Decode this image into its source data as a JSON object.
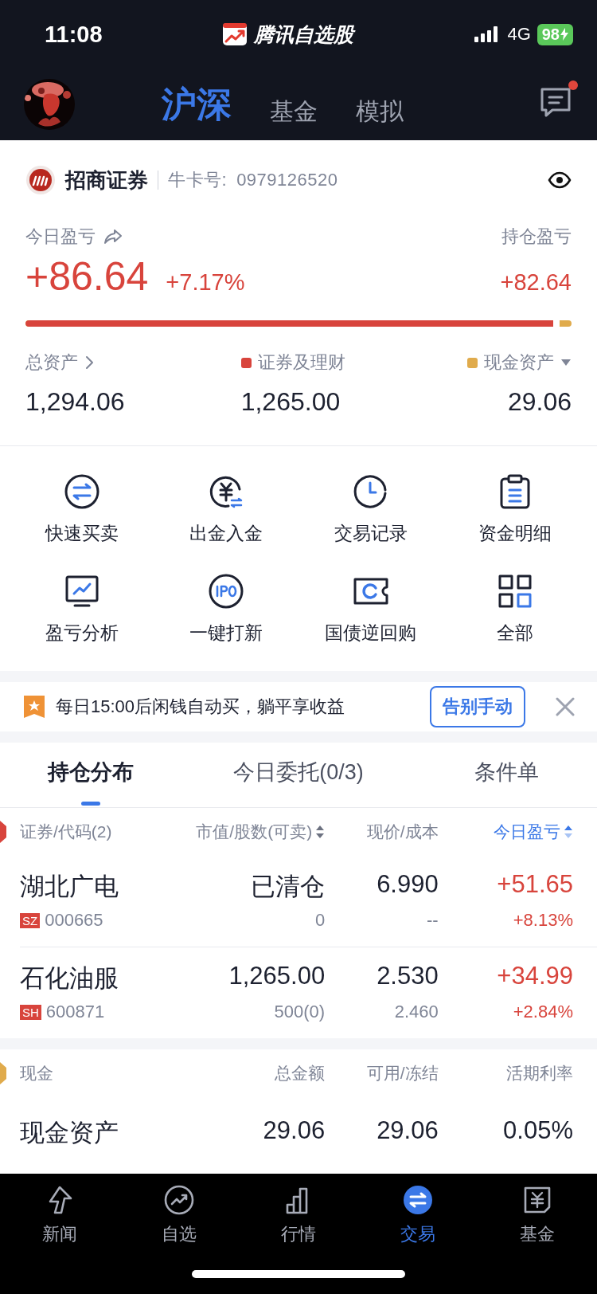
{
  "status_bar": {
    "time": "11:08",
    "app_name": "腾讯自选股",
    "network": "4G",
    "battery": "98"
  },
  "header": {
    "tabs": [
      {
        "label": "沪深",
        "selected": true
      },
      {
        "label": "基金",
        "selected": false
      },
      {
        "label": "模拟",
        "selected": false
      }
    ],
    "messages_unread": true
  },
  "account": {
    "broker": "招商证券",
    "card_label": "牛卡号:",
    "card_number": "0979126520",
    "today_pnl_label": "今日盈亏",
    "today_pnl": "+86.64",
    "today_pnl_pct": "+7.17%",
    "position_pnl_label": "持仓盈亏",
    "position_pnl": "+82.64",
    "allocation": {
      "level": 0.978
    },
    "assets": [
      {
        "label": "总资产",
        "value": "1,294.06"
      },
      {
        "label": "证券及理财",
        "value": "1,265.00",
        "color": "#d8443c"
      },
      {
        "label": "现金资产",
        "value": "29.06",
        "color": "#e0ab4c"
      }
    ]
  },
  "shortcuts": [
    {
      "label": "快速买卖"
    },
    {
      "label": "出金入金"
    },
    {
      "label": "交易记录"
    },
    {
      "label": "资金明细"
    },
    {
      "label": "盈亏分析"
    },
    {
      "label": "一键打新"
    },
    {
      "label": "国债逆回购"
    },
    {
      "label": "全部"
    }
  ],
  "banner": {
    "text": "每日15:00后闲钱自动买，躺平享收益",
    "button": "告别手动"
  },
  "position_tabs": [
    {
      "label": "持仓分布",
      "selected": true
    },
    {
      "label": "今日委托(0/3)",
      "selected": false
    },
    {
      "label": "条件单",
      "selected": false
    }
  ],
  "holdings": {
    "columns": [
      {
        "label": "证券/代码(2)",
        "sortable": false,
        "selected": false
      },
      {
        "label": "市值/股数(可卖)",
        "sortable": true,
        "selected": false
      },
      {
        "label": "现价/成本",
        "sortable": false,
        "selected": false
      },
      {
        "label": "今日盈亏",
        "sortable": true,
        "selected": true
      }
    ],
    "rows": [
      {
        "name": "湖北广电",
        "market": "SZ",
        "code": "000665",
        "value": "已清仓",
        "shares": "0",
        "price": "6.990",
        "cost": "--",
        "pnl": "+51.65",
        "pnl_pct": "+8.13%"
      },
      {
        "name": "石化油服",
        "market": "SH",
        "code": "600871",
        "value": "1,265.00",
        "shares": "500(0)",
        "price": "2.530",
        "cost": "2.460",
        "pnl": "+34.99",
        "pnl_pct": "+2.84%"
      }
    ]
  },
  "cash": {
    "columns": [
      "现金",
      "总金额",
      "可用/冻结",
      "活期利率"
    ],
    "rows": [
      {
        "name": "现金资产",
        "total": "29.06",
        "available": "29.06",
        "rate": "0.05%"
      }
    ]
  },
  "bottom_nav": [
    {
      "label": "新闻",
      "selected": false
    },
    {
      "label": "自选",
      "selected": false
    },
    {
      "label": "行情",
      "selected": false
    },
    {
      "label": "交易",
      "selected": true
    },
    {
      "label": "基金",
      "selected": false
    }
  ]
}
